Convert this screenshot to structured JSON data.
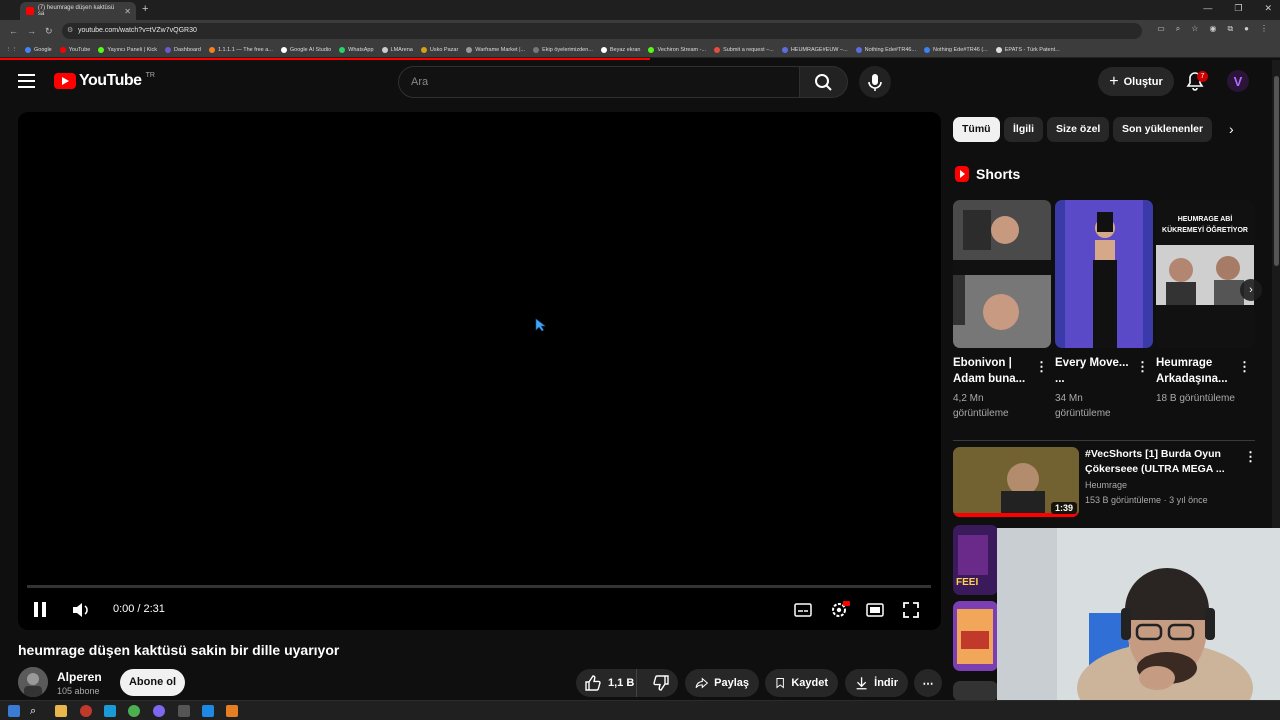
{
  "browser": {
    "tab_title": "(7) heumrage düşen kaktüsü sa",
    "url": "youtube.com/watch?v=tVZw7vQGR30",
    "bookmarks": [
      "Google",
      "YouTube",
      "Yayıncı Paneli | Kick",
      "Dashboard",
      "1.1.1.1 — The free a...",
      "Google AI Studio",
      "WhatsApp",
      "LMArena",
      "Usko Pazar",
      "Warframe Market |...",
      "Ekip öyelerimizden...",
      "Beyaz ekran",
      "Vechiron Stream -...",
      "Submit a request –...",
      "HEUMRAGE#EUW –...",
      "Nothing Ede#TR46...",
      "Nothing Ede#TR46 (...",
      "EPATS - Türk Patent..."
    ]
  },
  "header": {
    "logo_text": "YouTube",
    "country_code": "TR",
    "search_placeholder": "Ara",
    "create_label": "Oluştur",
    "notification_count": "7",
    "avatar_letter": "V"
  },
  "player": {
    "current_time": "0:00",
    "separator": "/",
    "duration": "2:31",
    "progress_fraction": 0.0,
    "hd_badge": "HD"
  },
  "video": {
    "title": "heumrage düşen kaktüsü sakin bir dille uyarıyor",
    "channel_name": "Alperen",
    "subscribers": "105 abone",
    "subscribe_label": "Abone ol",
    "likes": "1,1 B",
    "share_label": "Paylaş",
    "save_label": "Kaydet",
    "download_label": "İndir"
  },
  "sidebar": {
    "chips": [
      "Tümü",
      "İlgili",
      "Size özel",
      "Son yüklenenler"
    ],
    "active_chip": 0,
    "shorts_heading": "Shorts",
    "shorts": [
      {
        "title": "Ebonivon | Adam buna...",
        "views": "4,2 Mn görüntüleme"
      },
      {
        "title": "Every Move... ...",
        "views": "34 Mn görüntüleme"
      },
      {
        "title": "Heumrage Arkadaşına...",
        "views": "18 B görüntüleme",
        "overlay_text": "HEUMRAGE ABİ KÜKREMEYİ ÖĞRETİYOR"
      }
    ],
    "videos": [
      {
        "title": "#VecShorts [1] Burda Oyun Çökerseee (ULTRA MEGA ...",
        "channel": "Heumrage",
        "views": "153 B görüntüleme",
        "age": "3 yıl önce",
        "duration": "1:39"
      }
    ]
  },
  "colors": {
    "background": "#0f0f0f",
    "brand_red": "#ff0000",
    "chip_bg": "#272727",
    "text_secondary": "#aaaaaa"
  }
}
